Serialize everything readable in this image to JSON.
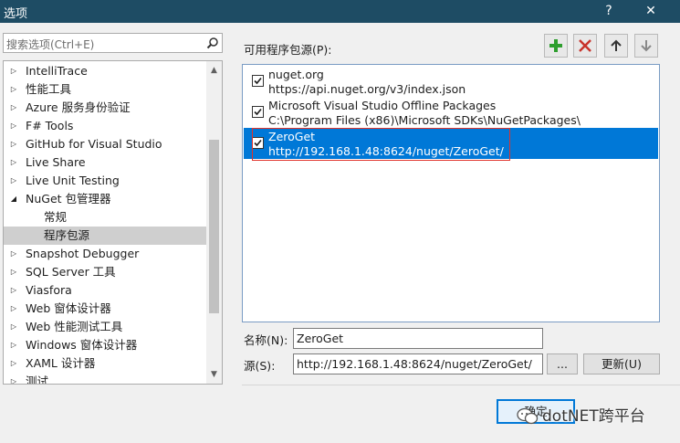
{
  "window": {
    "title": "选项",
    "help_label": "?",
    "close_label": "✕"
  },
  "search": {
    "placeholder": "搜索选项(Ctrl+E)"
  },
  "tree": {
    "items": [
      {
        "label": "IntelliTrace",
        "arrow": "▷"
      },
      {
        "label": "性能工具",
        "arrow": "▷"
      },
      {
        "label": "Azure 服务身份验证",
        "arrow": "▷"
      },
      {
        "label": "F# Tools",
        "arrow": "▷"
      },
      {
        "label": "GitHub for Visual Studio",
        "arrow": "▷"
      },
      {
        "label": "Live Share",
        "arrow": "▷"
      },
      {
        "label": "Live Unit Testing",
        "arrow": "▷"
      },
      {
        "label": "NuGet 包管理器",
        "arrow": "◢"
      },
      {
        "label": "常规",
        "arrow": ""
      },
      {
        "label": "程序包源",
        "arrow": ""
      },
      {
        "label": "Snapshot Debugger",
        "arrow": "▷"
      },
      {
        "label": "SQL Server 工具",
        "arrow": "▷"
      },
      {
        "label": "Viasfora",
        "arrow": "▷"
      },
      {
        "label": "Web 窗体设计器",
        "arrow": "▷"
      },
      {
        "label": "Web 性能测试工具",
        "arrow": "▷"
      },
      {
        "label": "Windows 窗体设计器",
        "arrow": "▷"
      },
      {
        "label": "XAML 设计器",
        "arrow": "▷"
      },
      {
        "label": "测试",
        "arrow": "▷"
      }
    ],
    "selected_label": "程序包源"
  },
  "sources": {
    "label": "可用程序包源(P):",
    "items": [
      {
        "name": "nuget.org",
        "url": "https://api.nuget.org/v3/index.json",
        "checked": true
      },
      {
        "name": "Microsoft Visual Studio Offline Packages",
        "url": "C:\\Program Files (x86)\\Microsoft SDKs\\NuGetPackages\\",
        "checked": true
      },
      {
        "name": "ZeroGet",
        "url": "http://192.168.1.48:8624/nuget/ZeroGet/",
        "checked": true
      }
    ]
  },
  "toolbar": {
    "add_icon": "plus-icon",
    "remove_icon": "x-icon",
    "up_icon": "arrow-up-icon",
    "down_icon": "arrow-down-icon"
  },
  "form": {
    "name_label": "名称(N):",
    "name_value": "ZeroGet",
    "source_label": "源(S):",
    "source_value": "http://192.168.1.48:8624/nuget/ZeroGet/",
    "browse_label": "...",
    "update_label": "更新(U)"
  },
  "ok_label": "确定",
  "watermark": "dotNET跨平台",
  "colors": {
    "titlebar": "#1e4c64",
    "selection": "#0078d7",
    "add_green": "#2e9e2e",
    "remove_red": "#c8332b"
  }
}
